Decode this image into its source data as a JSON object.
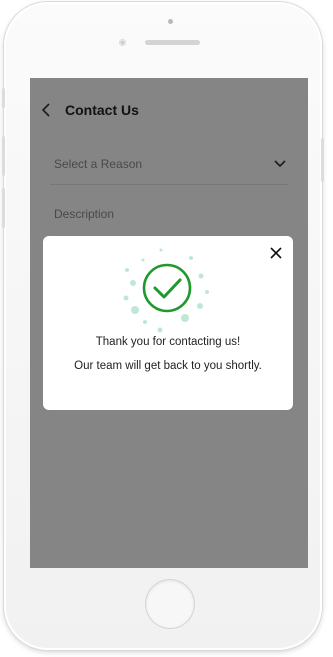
{
  "app": {
    "header_title": "Contact Us",
    "select_placeholder": "Select a Reason",
    "description_placeholder": "Description"
  },
  "modal": {
    "title": "Thank you for contacting us!",
    "message": "Our team will get back to you shortly.",
    "success_color": "#1e9a2c",
    "bubble_color": "#bfe7d6"
  },
  "icons": {
    "back": "back-arrow-icon",
    "chevron": "chevron-down-icon",
    "success": "check-circle-icon",
    "close": "close-icon"
  }
}
